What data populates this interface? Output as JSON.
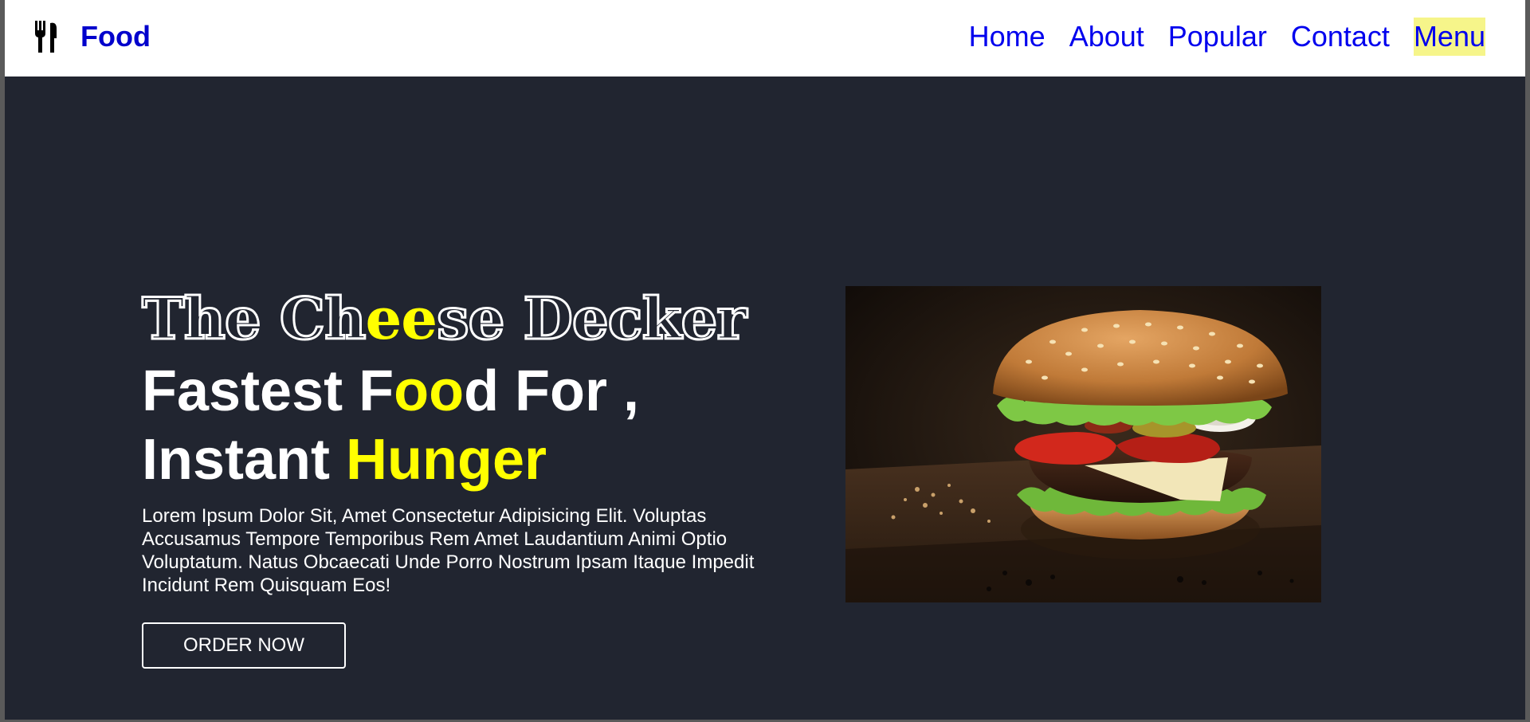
{
  "brand": {
    "icon": "fork-knife-icon",
    "name": "Food",
    "color": "#0000cc"
  },
  "nav": {
    "links": [
      {
        "label": "Home",
        "active": false
      },
      {
        "label": "About",
        "active": false
      },
      {
        "label": "Popular",
        "active": false
      },
      {
        "label": "Contact",
        "active": false
      },
      {
        "label": "Menu",
        "active": true
      }
    ],
    "link_color": "#0000ee",
    "active_highlight": "#f6f58a"
  },
  "hero": {
    "title_part1": "The Ch",
    "title_highlight": "ee",
    "title_part2": "se Decker",
    "line1_part1": "Fastest F",
    "line1_highlight": "oo",
    "line1_part2": "d For ,",
    "line2_part1": "Instant ",
    "line2_highlight": "Hunger",
    "description": "Lorem Ipsum Dolor Sit, Amet Consectetur Adipisicing Elit. Voluptas Accusamus Tempore Temporibus Rem Amet Laudantium Animi Optio Voluptatum. Natus Obcaecati Unde Porro Nostrum Ipsam Itaque Impedit Incidunt Rem Quisquam Eos!",
    "button_label": "ORDER NOW",
    "image": "cheeseburger-photo",
    "background": "#212530",
    "accent": "#ffff00"
  }
}
